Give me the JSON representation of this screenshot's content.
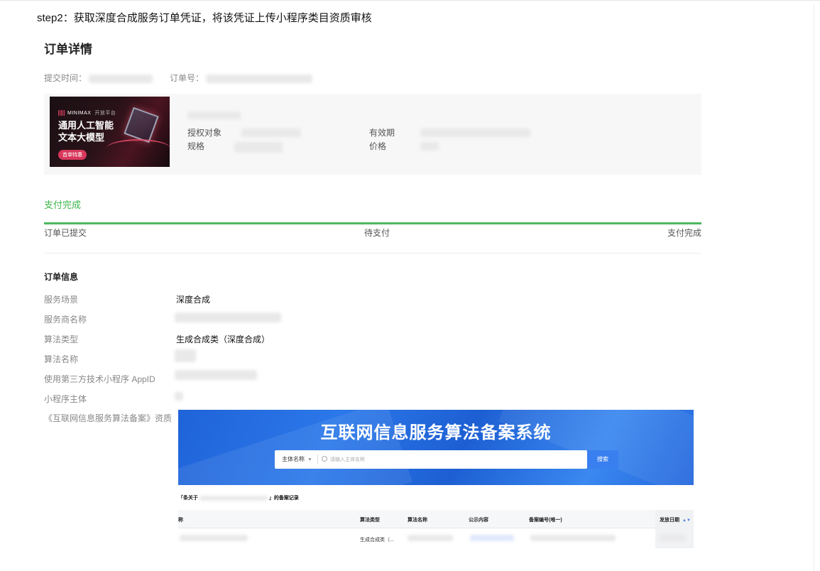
{
  "step_title": "step2：获取深度合成服务订单凭证，将该凭证上传小程序类目资质审核",
  "order_detail": {
    "title": "订单详情",
    "submit_time_label": "提交时间：",
    "order_no_label": "订单号："
  },
  "product": {
    "image": {
      "logo_text": "MINIMAX",
      "logo_sub": "开放平台",
      "headline": "通用人工智能文本大模型",
      "badge": "首单特惠"
    },
    "auth_target_label": "授权对象",
    "spec_label": "规格",
    "validity_label": "有效期",
    "price_label": "价格"
  },
  "payment": {
    "status": "支付完成",
    "progress_percent": 100,
    "steps": [
      "订单已提交",
      "待支付",
      "支付完成"
    ],
    "accent_color": "#4cb85e"
  },
  "order_info": {
    "section_title": "订单信息",
    "rows": [
      {
        "label": "服务场景",
        "value": "深度合成"
      },
      {
        "label": "服务商名称",
        "value": ""
      },
      {
        "label": "算法类型",
        "value": "生成合成类（深度合成）"
      },
      {
        "label": "算法名称",
        "value": ""
      },
      {
        "label": "使用第三方技术小程序 AppID",
        "value": ""
      },
      {
        "label": "小程序主体",
        "value": ""
      },
      {
        "label": "《互联网信息服务算法备案》资质",
        "value": ""
      }
    ]
  },
  "filing_system": {
    "title": "互联网信息服务算法备案系统",
    "search_select": "主体名称",
    "search_placeholder": "请输入主体名称",
    "search_button": "搜索",
    "record_caption_prefix": "「条关于",
    "record_caption_suffix": "」的备案记录",
    "table": {
      "headers": [
        "称",
        "算法类型",
        "算法名称",
        "公示内容",
        "备案编号(唯一)",
        "发放日期"
      ],
      "row": {
        "algorithm_type": "生成合成类（..."
      }
    }
  }
}
